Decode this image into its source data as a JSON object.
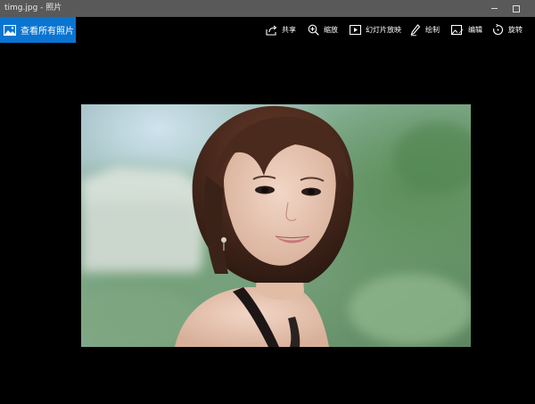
{
  "window": {
    "title": "timg.jpg - 照片"
  },
  "toolbar": {
    "view_all_label": "查看所有照片",
    "share_label": "共享",
    "zoom_label": "缩放",
    "slideshow_label": "幻灯片放映",
    "draw_label": "绘制",
    "edit_label": "编辑",
    "rotate_label": "旋转"
  },
  "photo": {
    "file": "timg.jpg"
  },
  "colors": {
    "accent": "#0a74d1",
    "background": "#000000",
    "titlebar": "#595959"
  }
}
